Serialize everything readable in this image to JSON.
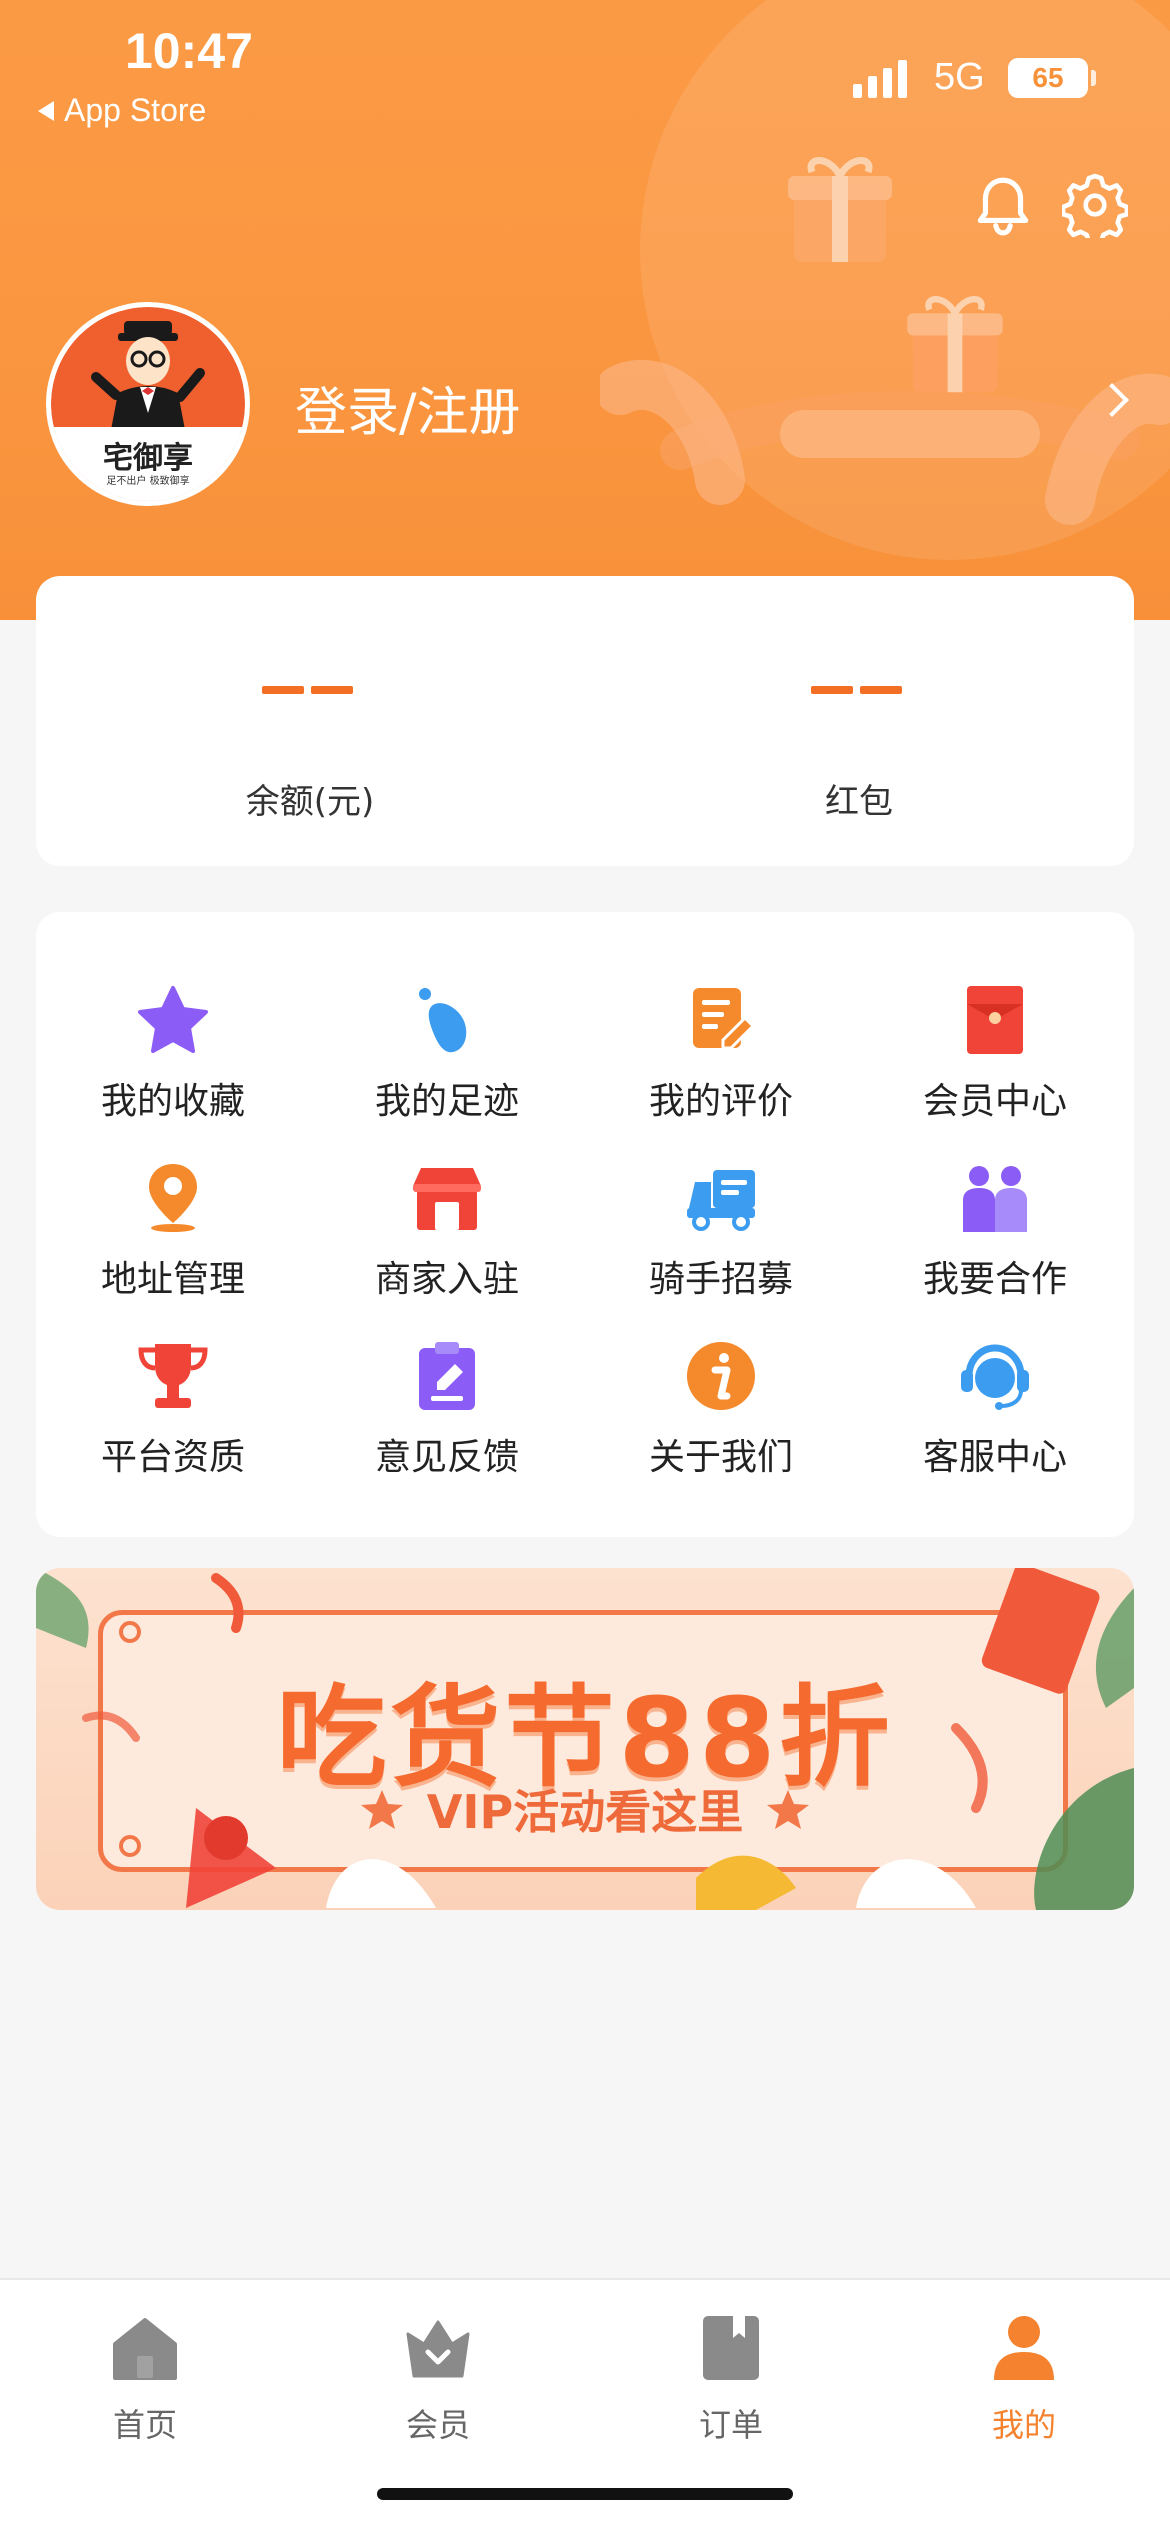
{
  "status_bar": {
    "time": "10:47",
    "back_app": "App Store",
    "network": "5G",
    "battery": "65"
  },
  "header": {
    "icons": [
      "bell-icon",
      "gear-icon"
    ],
    "avatar_title": "宅御享",
    "avatar_subtitle": "足不出户 极致御享",
    "login_label": "登录/注册",
    "gradient_color": "#fb9a45"
  },
  "balance": {
    "items": [
      {
        "value": "——",
        "label": "余额(元)"
      },
      {
        "value": "——",
        "label": "红包"
      }
    ],
    "accent_color": "#f36f25"
  },
  "menu": {
    "items": [
      {
        "label": "我的收藏",
        "icon": "star-icon",
        "color": "#8b5cf6"
      },
      {
        "label": "我的足迹",
        "icon": "footprint-icon",
        "color": "#3b9cf0"
      },
      {
        "label": "我的评价",
        "icon": "review-edit-icon",
        "color": "#f58a2c"
      },
      {
        "label": "会员中心",
        "icon": "red-envelope-icon",
        "color": "#f04438"
      },
      {
        "label": "地址管理",
        "icon": "location-pin-icon",
        "color": "#f58a2c"
      },
      {
        "label": "商家入驻",
        "icon": "store-icon",
        "color": "#f04438"
      },
      {
        "label": "骑手招募",
        "icon": "delivery-truck-icon",
        "color": "#3b9cf0"
      },
      {
        "label": "我要合作",
        "icon": "partners-icon",
        "color": "#8b5cf6"
      },
      {
        "label": "平台资质",
        "icon": "trophy-icon",
        "color": "#f04438"
      },
      {
        "label": "意见反馈",
        "icon": "feedback-clipboard-icon",
        "color": "#8b5cf6"
      },
      {
        "label": "关于我们",
        "icon": "info-icon",
        "color": "#f58a2c"
      },
      {
        "label": "客服中心",
        "icon": "headset-icon",
        "color": "#3b9cf0"
      }
    ]
  },
  "banner": {
    "title": "吃货节88折",
    "subtitle": "VIP活动看这里"
  },
  "tabbar": {
    "tabs": [
      {
        "label": "首页",
        "icon": "home-icon",
        "active": false
      },
      {
        "label": "会员",
        "icon": "member-crown-icon",
        "active": false
      },
      {
        "label": "订单",
        "icon": "order-book-icon",
        "active": false
      },
      {
        "label": "我的",
        "icon": "profile-icon",
        "active": true
      }
    ],
    "active_color": "#f4822e",
    "inactive_color": "#8a8a8a"
  }
}
